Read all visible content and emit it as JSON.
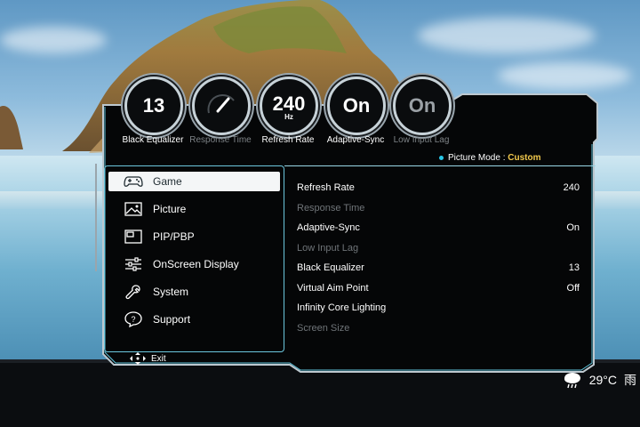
{
  "gauges": [
    {
      "value": "13",
      "unit": "",
      "label": "Black Equalizer",
      "active": true
    },
    {
      "value": "",
      "unit": "",
      "label": "Response Time",
      "active": false
    },
    {
      "value": "240",
      "unit": "Hz",
      "label": "Refresh Rate",
      "active": true
    },
    {
      "value": "On",
      "unit": "",
      "label": "Adaptive-Sync",
      "active": true
    },
    {
      "value": "On",
      "unit": "",
      "label": "Low Input Lag",
      "active": false
    }
  ],
  "picture_mode": {
    "label": "Picture Mode :",
    "value": "Custom"
  },
  "menu": [
    {
      "label": "Game",
      "icon": "gamepad-icon",
      "selected": true
    },
    {
      "label": "Picture",
      "icon": "picture-icon",
      "selected": false
    },
    {
      "label": "PIP/PBP",
      "icon": "pip-icon",
      "selected": false
    },
    {
      "label": "OnScreen Display",
      "icon": "sliders-icon",
      "selected": false
    },
    {
      "label": "System",
      "icon": "wrench-icon",
      "selected": false
    },
    {
      "label": "Support",
      "icon": "help-icon",
      "selected": false
    }
  ],
  "settings": [
    {
      "label": "Refresh Rate",
      "value": "240",
      "enabled": true
    },
    {
      "label": "Response Time",
      "value": "",
      "enabled": false
    },
    {
      "label": "Adaptive-Sync",
      "value": "On",
      "enabled": true
    },
    {
      "label": "Low Input Lag",
      "value": "",
      "enabled": false
    },
    {
      "label": "Black Equalizer",
      "value": "13",
      "enabled": true
    },
    {
      "label": "Virtual Aim Point",
      "value": "Off",
      "enabled": true
    },
    {
      "label": "Infinity Core Lighting",
      "value": "",
      "enabled": true
    },
    {
      "label": "Screen Size",
      "value": "",
      "enabled": false
    }
  ],
  "footer": {
    "exit_label": "Exit"
  },
  "weather": {
    "temperature": "29°C",
    "condition": "雨",
    "icon": "cloud-rain-icon"
  },
  "colors": {
    "accent": "#29c6e6",
    "mode_value": "#f2c94c",
    "panel_bg": "#050607"
  }
}
